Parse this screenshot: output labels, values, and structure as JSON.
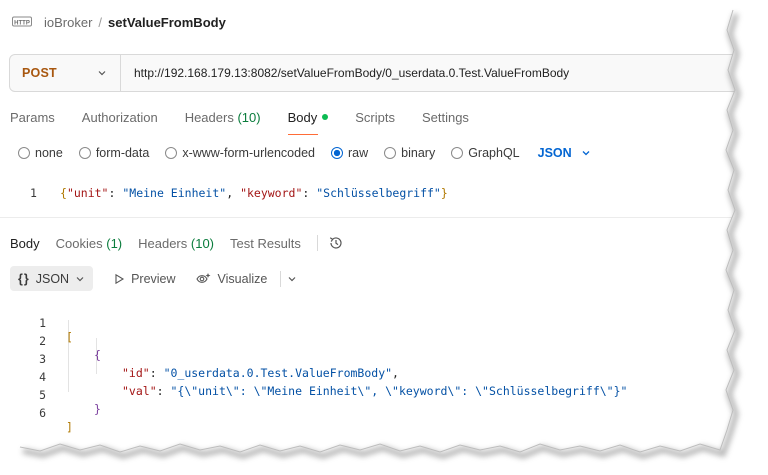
{
  "breadcrumb": {
    "icon": "http-icon",
    "workspace": "ioBroker",
    "separator": "/",
    "request": "setValueFromBody"
  },
  "urlbar": {
    "method": "POST",
    "url": "http://192.168.179.13:8082/setValueFromBody/0_userdata.0.Test.ValueFromBody"
  },
  "request_tabs": [
    {
      "label": "Params"
    },
    {
      "label": "Authorization"
    },
    {
      "label": "Headers",
      "count": "(10)"
    },
    {
      "label": "Body",
      "active": true
    },
    {
      "label": "Scripts"
    },
    {
      "label": "Settings"
    }
  ],
  "body_types": [
    "none",
    "form-data",
    "x-www-form-urlencoded",
    "raw",
    "binary",
    "GraphQL"
  ],
  "body_type_selected": "raw",
  "body_format": "JSON",
  "request_body": {
    "line_number": "1",
    "line": {
      "open": "{",
      "key1": "\"unit\"",
      "colon1": ": ",
      "val1": "\"Meine Einheit\"",
      "comma": ", ",
      "key2": "\"keyword\"",
      "colon2": ": ",
      "val2": "\"Schlüsselbegriff\"",
      "close": "}"
    }
  },
  "response_tabs": [
    {
      "label": "Body",
      "active": true
    },
    {
      "label": "Cookies",
      "count": "(1)"
    },
    {
      "label": "Headers",
      "count": "(10)"
    },
    {
      "label": "Test Results"
    }
  ],
  "response_toolbar": {
    "brace": "{}",
    "format": "JSON",
    "preview": "Preview",
    "visualize": "Visualize"
  },
  "response_body": {
    "line_numbers": [
      "1",
      "2",
      "3",
      "4",
      "5",
      "6"
    ],
    "l1": "[",
    "l2": "{",
    "l3": {
      "key": "\"id\"",
      "colon": ": ",
      "val": "\"0_userdata.0.Test.ValueFromBody\"",
      "comma": ","
    },
    "l4": {
      "key": "\"val\"",
      "colon": ": ",
      "val": "\"{\\\"unit\\\": \\\"Meine Einheit\\\", \\\"keyword\\\": \\\"Schlüsselbegriff\\\"}\""
    },
    "l5": "}",
    "l6": "]"
  },
  "colors": {
    "method": "#a8570f",
    "accent": "#0265d2",
    "body_dot": "#0cbb52",
    "count": "#0a7c3c",
    "json_key": "#a31515",
    "json_string": "#0451a5"
  }
}
